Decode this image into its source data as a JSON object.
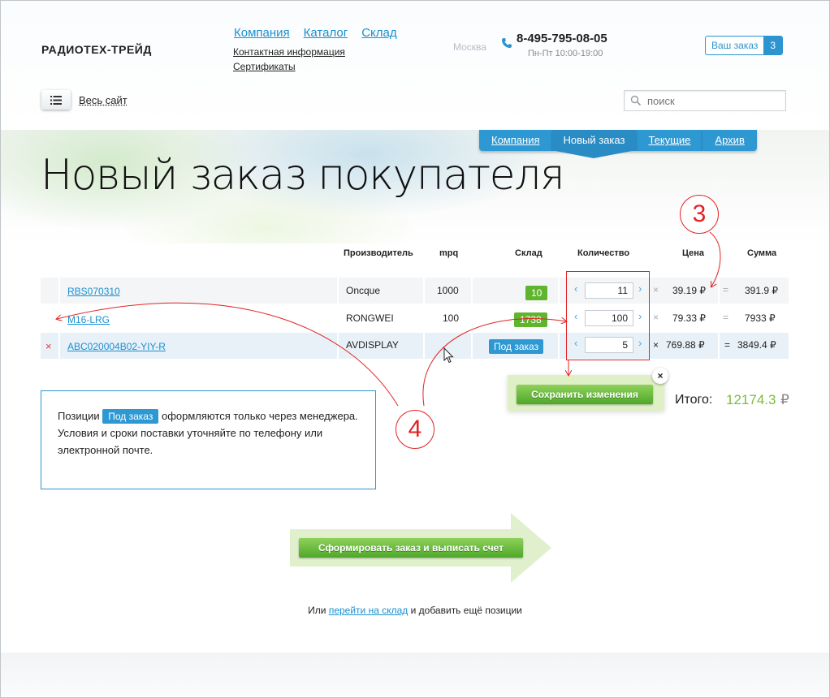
{
  "header": {
    "logo": "РАДИОТЕХ-ТРЕЙД",
    "nav": [
      "Компания",
      "Каталог",
      "Склад"
    ],
    "subnav": [
      "Контактная информация",
      "Сертификаты"
    ],
    "city": "Москва",
    "phone": "8-495-795-08-05",
    "hours": "Пн-Пт 10:00-19:00",
    "order_label": "Ваш заказ",
    "order_count": "3",
    "all_site": "Весь сайт",
    "search_placeholder": "поиск"
  },
  "tabs": [
    "Компания",
    "Новый заказ",
    "Текущие",
    "Архив"
  ],
  "active_tab": "Новый заказ",
  "page_title": "Новый заказ покупателя",
  "table": {
    "headers": {
      "manufacturer": "Производитель",
      "mpq": "mpq",
      "stock": "Склад",
      "quantity": "Количество",
      "price": "Цена",
      "sum": "Сумма"
    },
    "rows": [
      {
        "part": "RBS070310",
        "manufacturer": "Oncque",
        "mpq": "1000",
        "stock": "10",
        "qty": "11",
        "price": "39.19 ₽",
        "sum": "391.9 ₽"
      },
      {
        "part": "M16-LRG",
        "manufacturer": "RONGWEI",
        "mpq": "100",
        "stock": "1738",
        "qty": "100",
        "price": "79.33 ₽",
        "sum": "7933 ₽"
      },
      {
        "part": "ABC020004B02-YIY-R",
        "manufacturer": "AVDISPLAY",
        "mpq": "",
        "stock": "Под заказ",
        "qty": "5",
        "price": "769.88 ₽",
        "sum": "3849.4 ₽"
      }
    ],
    "multiply_sign": "×",
    "equals_sign": "=",
    "delete_sign": "×"
  },
  "save_button": "Сохранить изменения",
  "close_sign": "×",
  "total": {
    "label": "Итого:",
    "value": "12174.3",
    "currency": "₽"
  },
  "info": {
    "before": "Позиции",
    "badge": "Под заказ",
    "after": "оформляются только через менеджера.",
    "line2": "Условия и сроки поставки уточняйте по телефону или электронной почте."
  },
  "submit_button": "Сформировать заказ и выписать счет",
  "footer": {
    "before": "Или",
    "link": "перейти на склад",
    "after": "и добавить ещё позиции"
  },
  "annotations": {
    "three": "3",
    "four": "4"
  },
  "colors": {
    "accent": "#2e94d0",
    "green": "#5fb52e",
    "annotation": "#e32222",
    "total": "#7bbd3f"
  }
}
